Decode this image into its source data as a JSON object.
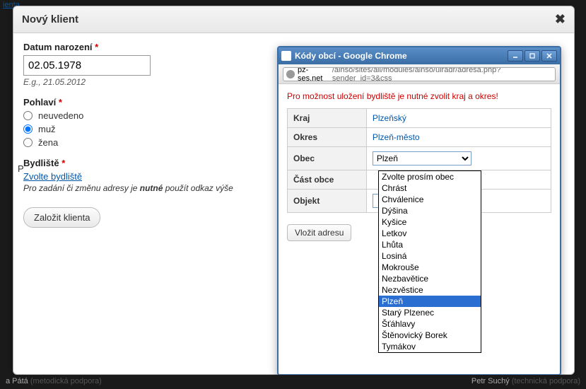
{
  "bg": {
    "topLink": "ienta",
    "left": "a Pátá",
    "leftRole": "(metodická podpora)",
    "right": "Petr Suchý",
    "rightRole": "(technická podpora)"
  },
  "dialog": {
    "title": "Nový klient",
    "dob": {
      "label": "Datum narození",
      "value": "02.05.1978",
      "hint": "E.g., 21.05.2012"
    },
    "gender": {
      "label": "Pohlaví",
      "opts": [
        "neuvedeno",
        "muž",
        "žena"
      ],
      "selected": "muž"
    },
    "addr": {
      "label": "Bydliště",
      "link": "Zvolte bydliště",
      "note_pre": "Pro zadání či změnu adresy je ",
      "note_b": "nutné",
      "note_post": " použít odkaz výše"
    },
    "submit": "Založit klienta",
    "sideLetter": "P"
  },
  "popup": {
    "title": "Kódy obcí - Google Chrome",
    "url_domain": "pz-ses.net",
    "url_path": "/ainso/sites/all/modules/ainso/uiradr/adresa.php?sender_id=3&css",
    "warning": "Pro možnost uložení bydliště je nutné zvolit kraj a okres!",
    "rows": {
      "kraj": {
        "k": "Kraj",
        "v": "Plzeňský"
      },
      "okres": {
        "k": "Okres",
        "v": "Plzeň-město"
      },
      "obec": {
        "k": "Obec",
        "sel": "Plzeň"
      },
      "cast": {
        "k": "Část obce"
      },
      "objekt": {
        "k": "Objekt"
      }
    },
    "insert": "Vložit adresu",
    "options": [
      "Zvolte prosím obec",
      "Chrást",
      "Chválenice",
      "Dýšina",
      "Kyšice",
      "Letkov",
      "Lhůta",
      "Losiná",
      "Mokrouše",
      "Nezbavětice",
      "Nezvěstice",
      "Plzeň",
      "Starý Plzenec",
      "Šťáhlavy",
      "Štěnovický Borek",
      "Tymákov"
    ],
    "highlighted": "Plzeň"
  }
}
